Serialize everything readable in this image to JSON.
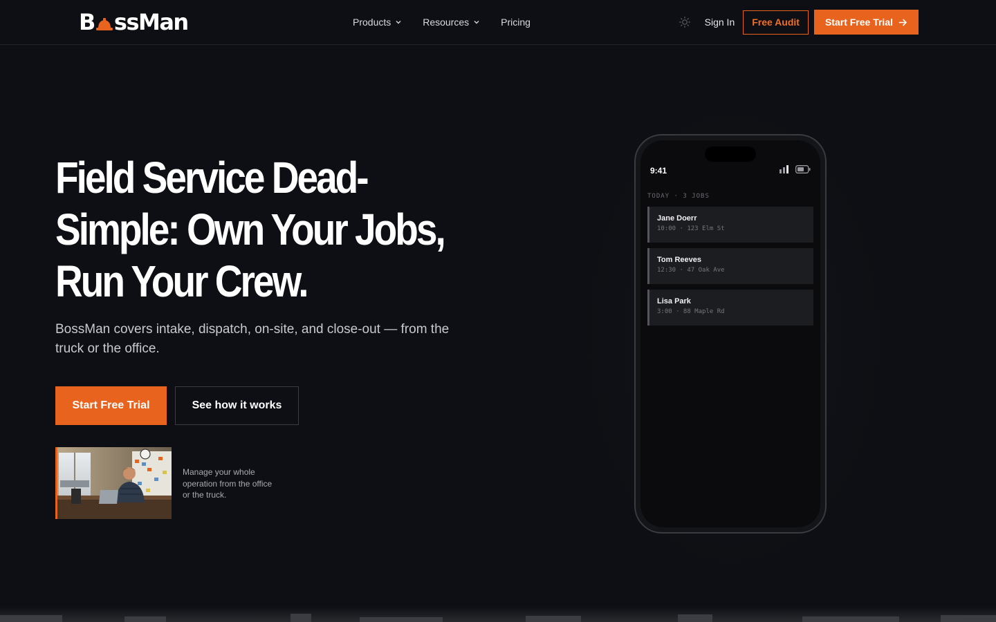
{
  "brand": {
    "name_part1": "B",
    "name_part2": "ssMan",
    "accent": "#e8631e"
  },
  "nav": {
    "links": [
      {
        "label": "Products",
        "has_dropdown": true
      },
      {
        "label": "Resources",
        "has_dropdown": true
      },
      {
        "label": "Pricing",
        "has_dropdown": false
      }
    ],
    "theme_toggle_icon": "sun-icon",
    "sign_in": "Sign In",
    "free_audit": "Free Audit",
    "start_trial": "Start Free Trial"
  },
  "hero": {
    "title_lines": [
      "Field Service Dead-",
      "Simple: Own Your Jobs,",
      "Run Your Crew."
    ],
    "subtitle": "BossMan covers intake, dispatch, on-site, and close-out — from the truck or the office.",
    "primary_cta": "Start Free Trial",
    "secondary_cta": "See how it works",
    "thumb_caption": "Manage your whole operation from the office or the truck."
  },
  "phone": {
    "time": "9:41",
    "jobs_header": "TODAY · 3 JOBS",
    "jobs": [
      {
        "name": "Jane Doerr",
        "meta": "10:00 · 123 Elm St"
      },
      {
        "name": "Tom Reeves",
        "meta": "12:30 · 47 Oak Ave"
      },
      {
        "name": "Lisa Park",
        "meta": "3:00 · 88 Maple Rd"
      }
    ]
  }
}
